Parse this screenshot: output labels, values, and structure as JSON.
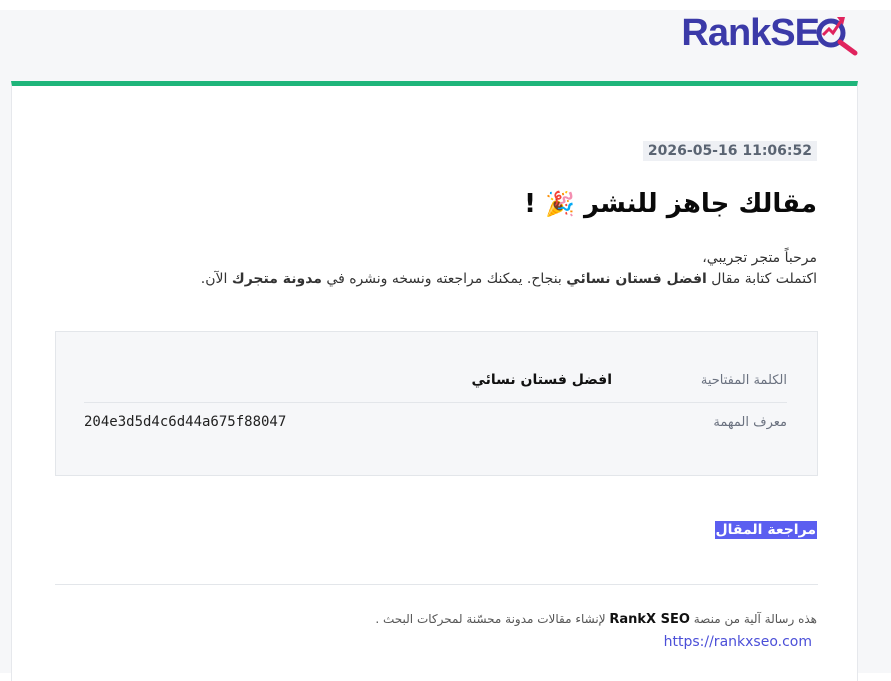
{
  "brand": {
    "logo_rank": "Rank",
    "logo_seo": "SE",
    "accent_color": "#1fb57a",
    "logo_color": "#3b3aa8",
    "logo_mag_color": "#e0245e"
  },
  "email": {
    "timestamp": "2026-05-16 11:06:52",
    "headline": "مقالك جاهز للنشر",
    "headline_emoji": "🎉",
    "headline_suffix": "!",
    "greeting_line": "مرحباً متجر تجريبي،",
    "body_prefix": "اكتملت كتابة مقال",
    "body_keyword": "افضل فستان نسائي",
    "body_middle": "بنجاح. يمكنك مراجعته ونسخه ونشره في",
    "body_bold_location": "مدونة متجرك",
    "body_suffix": "الآن."
  },
  "details": {
    "keyword_label": "الكلمة المفتاحية",
    "keyword_value": "افضل فستان نسائي",
    "task_label": "معرف المهمة",
    "task_value": "204e3d5d4c6d44a675f88047"
  },
  "actions": {
    "review_label": "مراجعة المقال",
    "button_color": "#5b5ef0"
  },
  "footer": {
    "text_prefix": "هذه رسالة آلية من منصة",
    "brand_name": "RankX SEO",
    "text_suffix": "لإنشاء مقالات مدونة محسّنة لمحركات البحث .",
    "link_url": "https://rankxseo.com"
  }
}
